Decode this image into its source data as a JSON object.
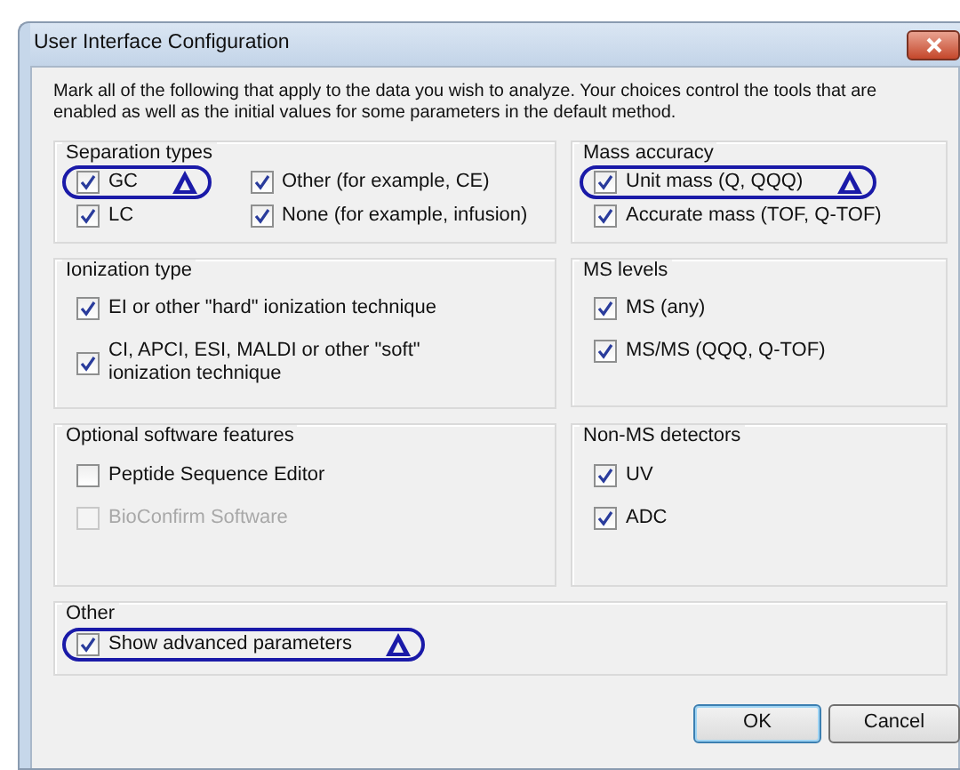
{
  "window": {
    "title": "User Interface Configuration"
  },
  "intro": "Mark all of the following that apply to the data you wish to analyze. Your choices control the tools that are enabled as well as the initial values for some parameters in the default method.",
  "groups": [
    {
      "title": "Separation types",
      "kind": "grid",
      "items": [
        {
          "label": "GC",
          "checked": true,
          "disabled": false,
          "highlighted": true
        },
        {
          "label": "Other (for example, CE)",
          "checked": true,
          "disabled": false,
          "highlighted": false
        },
        {
          "label": "LC",
          "checked": true,
          "disabled": false,
          "highlighted": false
        },
        {
          "label": "None (for example, infusion)",
          "checked": true,
          "disabled": false,
          "highlighted": false
        }
      ]
    },
    {
      "title": "Mass accuracy",
      "kind": "list",
      "items": [
        {
          "label": "Unit mass  (Q, QQQ)",
          "checked": true,
          "disabled": false,
          "highlighted": true
        },
        {
          "label": "Accurate mass  (TOF, Q-TOF)",
          "checked": true,
          "disabled": false,
          "highlighted": false
        }
      ]
    },
    {
      "title": "Ionization type",
      "kind": "list",
      "items": [
        {
          "label": "EI or other \"hard\" ionization technique",
          "checked": true,
          "disabled": false,
          "highlighted": false
        },
        {
          "label": "CI, APCI, ESI, MALDI or other \"soft\" ionization technique",
          "checked": true,
          "disabled": false,
          "highlighted": false
        }
      ]
    },
    {
      "title": "MS levels",
      "kind": "list",
      "items": [
        {
          "label": "MS  (any)",
          "checked": true,
          "disabled": false,
          "highlighted": false
        },
        {
          "label": "MS/MS  (QQQ, Q-TOF)",
          "checked": true,
          "disabled": false,
          "highlighted": false
        }
      ]
    },
    {
      "title": "Optional software features",
      "kind": "list",
      "items": [
        {
          "label": "Peptide Sequence Editor",
          "checked": false,
          "disabled": false,
          "highlighted": false
        },
        {
          "label": "BioConfirm Software",
          "checked": false,
          "disabled": true,
          "highlighted": false
        }
      ]
    },
    {
      "title": "Non-MS detectors",
      "kind": "list",
      "items": [
        {
          "label": "UV",
          "checked": true,
          "disabled": false,
          "highlighted": false
        },
        {
          "label": "ADC",
          "checked": true,
          "disabled": false,
          "highlighted": false
        }
      ]
    },
    {
      "title": "Other",
      "kind": "wide",
      "items": [
        {
          "label": "Show advanced parameters",
          "checked": true,
          "disabled": false,
          "highlighted": true
        }
      ]
    }
  ],
  "buttons": [
    {
      "label": "OK",
      "default": true
    },
    {
      "label": "Cancel",
      "default": false
    }
  ]
}
